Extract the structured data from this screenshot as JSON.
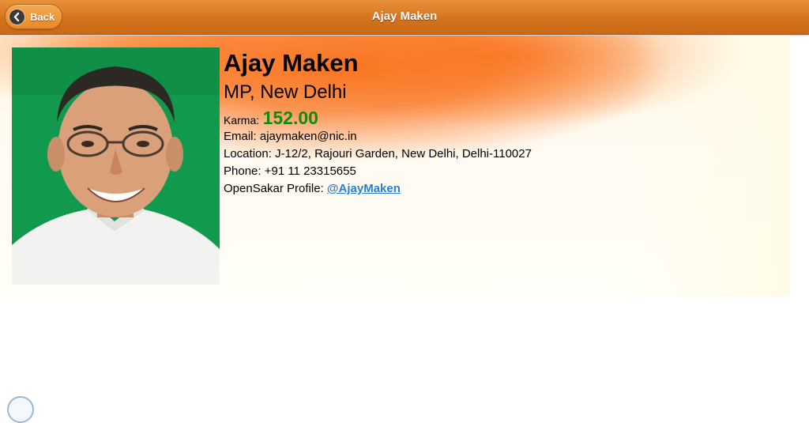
{
  "header": {
    "title": "Ajay Maken",
    "back_label": "Back",
    "back_icon": "chevron-left-icon"
  },
  "profile": {
    "name": "Ajay Maken",
    "designation": "MP, New Delhi",
    "karma_label": "Karma:",
    "karma_value": "152.00",
    "email_label": "Email:",
    "email": "ajaymaken@nic.in",
    "location_label": "Location:",
    "location": "J-12/2, Rajouri Garden, New Delhi, Delhi-110027",
    "phone_label": "Phone:",
    "phone": "+91 11 23315655",
    "opensakar_label": "OpenSakar Profile:",
    "opensakar_handle": "@AjayMaken"
  },
  "colors": {
    "header": "#d4731c",
    "karma": "#128a12",
    "link": "#2a7fd0",
    "photo_background": "#119a4e"
  }
}
